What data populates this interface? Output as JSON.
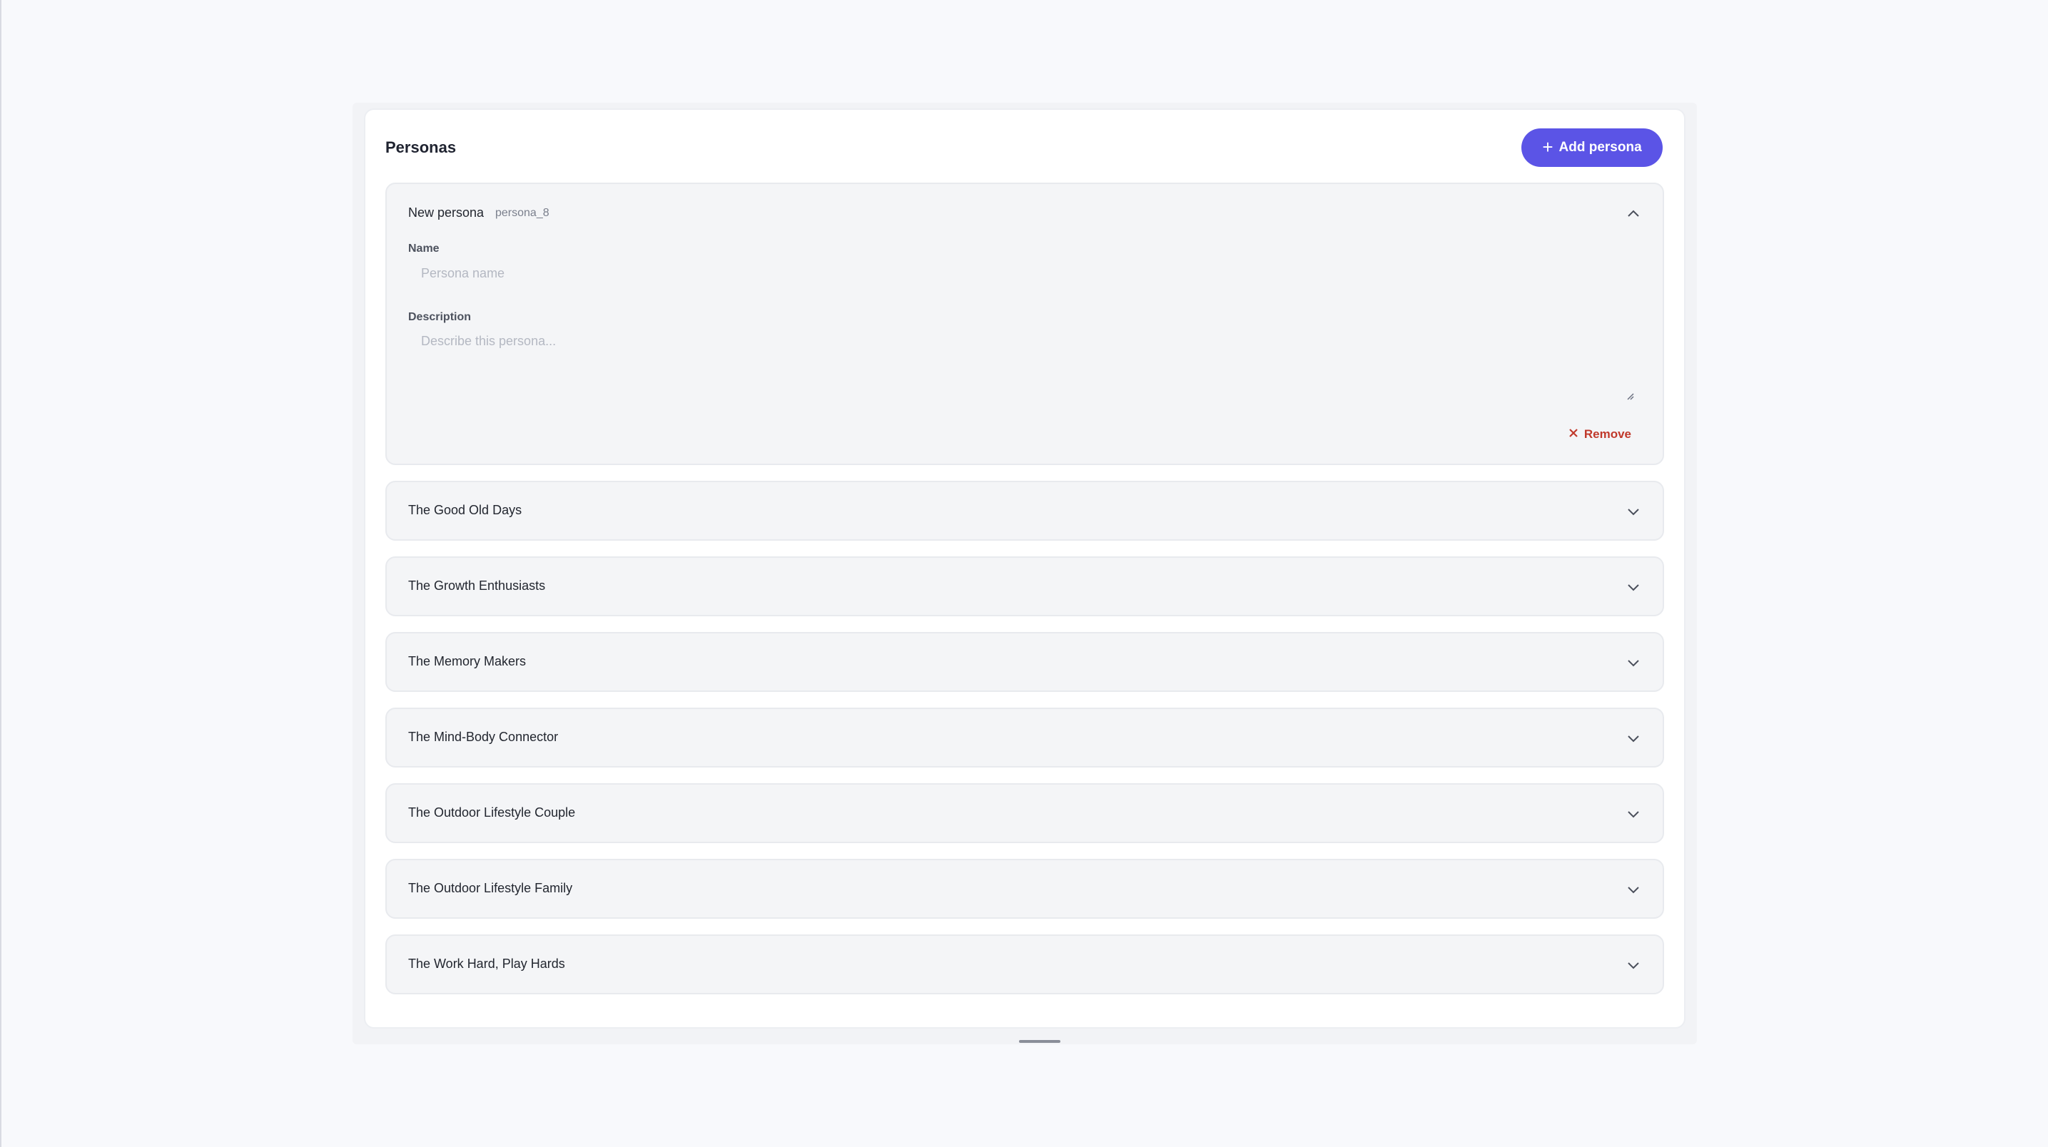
{
  "header": {
    "title": "Personas",
    "add_button_label": "Add persona",
    "add_icon": "+"
  },
  "expanded_persona": {
    "title": "New persona",
    "id": "persona_8",
    "name_label": "Name",
    "name_placeholder": "Persona name",
    "name_value": "",
    "description_label": "Description",
    "description_placeholder": "Describe this persona...",
    "description_value": "",
    "remove_label": "Remove"
  },
  "personas": [
    {
      "title": "The Good Old Days"
    },
    {
      "title": "The Growth Enthusiasts"
    },
    {
      "title": "The Memory Makers"
    },
    {
      "title": "The Mind-Body Connector"
    },
    {
      "title": "The Outdoor Lifestyle Couple"
    },
    {
      "title": "The Outdoor Lifestyle Family"
    },
    {
      "title": "The Work Hard, Play Hards"
    }
  ],
  "colors": {
    "accent": "#5b54e6",
    "danger": "#c0392b",
    "card_bg": "#f4f5f7",
    "page_bg": "#f8f9fc"
  }
}
